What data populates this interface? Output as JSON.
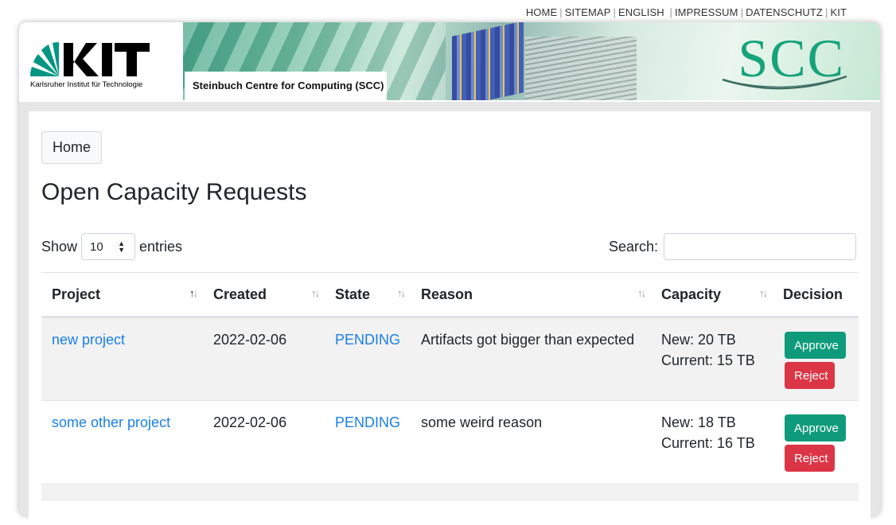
{
  "topnav": [
    "HOME",
    "SITEMAP",
    "ENGLISH",
    "IMPRESSUM",
    "DATENSCHUTZ",
    "KIT"
  ],
  "header": {
    "logo_text": "KIT",
    "logo_subtitle": "Karlsruher Institut für Technologie",
    "banner_label": "Steinbuch Centre for Computing (SCC)",
    "banner_logo": "SCC"
  },
  "breadcrumb": {
    "home_label": "Home"
  },
  "page_title": "Open Capacity Requests",
  "entries": {
    "show_label": "Show",
    "value": "10",
    "entries_label": "entries"
  },
  "search": {
    "label": "Search:",
    "value": ""
  },
  "table": {
    "columns": [
      "Project",
      "Created",
      "State",
      "Reason",
      "Capacity",
      "Decision"
    ],
    "rows": [
      {
        "project": "new project",
        "created": "2022-02-06",
        "state": "PENDING",
        "reason": "Artifacts got bigger than expected",
        "new": "New: 20 TB",
        "current": "Current: 15 TB",
        "approve": "Approve",
        "reject": "Reject"
      },
      {
        "project": "some other project",
        "created": "2022-02-06",
        "state": "PENDING",
        "reason": "some weird reason",
        "new": "New: 18 TB",
        "current": "Current: 16 TB",
        "approve": "Approve",
        "reject": "Reject"
      }
    ]
  },
  "colors": {
    "link": "#1a7fe6",
    "approve": "#0f9b7b",
    "reject": "#dc3545",
    "scc": "#17a37a"
  }
}
